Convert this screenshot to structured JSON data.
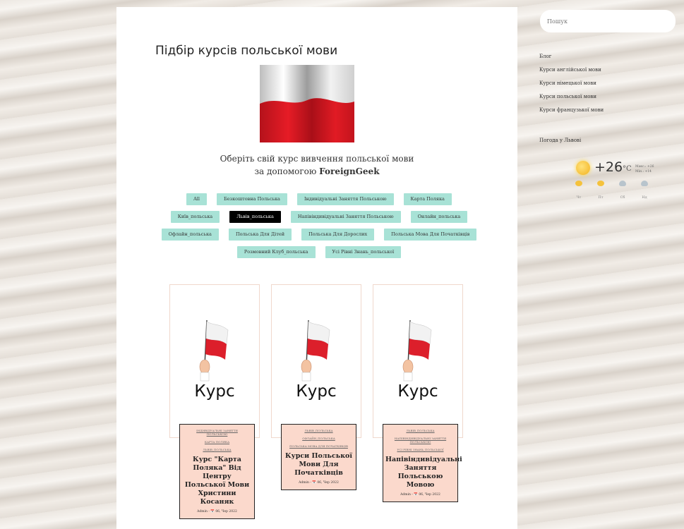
{
  "main": {
    "title": "Підбір курсів польської мови",
    "subtitle_line1": "Оберіть свій курс вивчення польської мови",
    "subtitle_line2_prefix": "за допомогою ",
    "subtitle_brand": "ForeignGeek"
  },
  "filters": [
    {
      "label": "All",
      "active": false
    },
    {
      "label": "Безкоштовна Польська",
      "active": false
    },
    {
      "label": "Індивідуальні Заняття Польською",
      "active": false
    },
    {
      "label": "Карта Поляка",
      "active": false
    },
    {
      "label": "Київ_польська",
      "active": false
    },
    {
      "label": "Львів_польська",
      "active": true
    },
    {
      "label": "Напівіндивідуальні Заняття Польською",
      "active": false
    },
    {
      "label": "Онлайн_польська",
      "active": false
    },
    {
      "label": "Офлайн_польська",
      "active": false
    },
    {
      "label": "Польська Для Дітей",
      "active": false
    },
    {
      "label": "Польська Для Дорослих",
      "active": false
    },
    {
      "label": "Польська Мова Для Початківців",
      "active": false
    },
    {
      "label": "Розмовний Клуб_польська",
      "active": false
    },
    {
      "label": "Усі Рівні Знань_польської",
      "active": false
    }
  ],
  "cards": [
    {
      "image_word": "Курс",
      "tags": [
        "ІНДИВІДУАЛЬНІ ЗАНЯТТЯ ПОЛЬСЬКОЮ",
        "КАРТА ПОЛЯКА",
        "ЛЬВІВ_ПОЛЬСЬКА"
      ],
      "title": "Курс \"Карта Поляка\" Від Центру Польської Мови Христини Косаняк",
      "meta": "Admin - 📅 06, Чер 2022"
    },
    {
      "image_word": "Курс",
      "tags": [
        "ЛЬВІВ_ПОЛЬСЬКА",
        "ОФЛАЙН_ПОЛЬСЬКА",
        "ПОЛЬСЬКА МОВА ДЛЯ ПОЧАТКІВЦІВ"
      ],
      "title": "Курси Польської Мови Для Початківців",
      "meta": "Admin - 📅 06, Чер 2022"
    },
    {
      "image_word": "Курс",
      "tags": [
        "ЛЬВІВ_ПОЛЬСЬКА",
        "НАПІВІНДИВІДУАЛЬНІ ЗАНЯТТЯ ПОЛЬСЬКОЮ",
        "УСІ РІВНІ ЗНАНЬ_ПОЛЬСЬКОЇ"
      ],
      "title": "Напівіндивідуальні Заняття Польською Мовою",
      "meta": "Admin - 📅 06, Чер 2022"
    }
  ],
  "sidebar": {
    "search_placeholder": "Пошук",
    "menu": [
      "Блог",
      "Курси англійської мови",
      "Курси німецької мови",
      "Курси польської мови",
      "Курси французької мови"
    ],
    "weather_title": "Погода у Львові",
    "weather": {
      "temp": "+26",
      "unit": "°C",
      "max": "Макс.: +26",
      "min": "Мін.: +14",
      "forecast": [
        {
          "day": "Чт",
          "icon": "sunny-icon"
        },
        {
          "day": "Пт",
          "icon": "sunny-icon"
        },
        {
          "day": "Сб",
          "icon": "cloudy-icon"
        },
        {
          "day": "Нд",
          "icon": "cloudy-icon"
        }
      ]
    }
  },
  "colors": {
    "filter_tag": "#a8e2d6",
    "filter_tag_active": "#000000",
    "card_info": "#fbd9cc"
  }
}
